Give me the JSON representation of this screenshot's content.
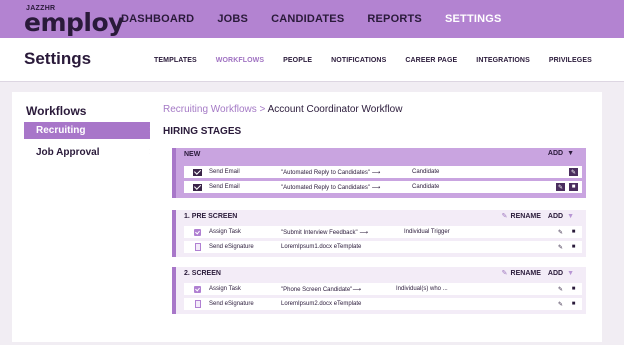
{
  "brand": {
    "small": "JAZZHR",
    "main": "employ"
  },
  "topnav": {
    "items": [
      {
        "label": "DASHBOARD"
      },
      {
        "label": "JOBS"
      },
      {
        "label": "CANDIDATES"
      },
      {
        "label": "REPORTS"
      },
      {
        "label": "SETTINGS",
        "active": true
      }
    ]
  },
  "settings": {
    "title": "Settings",
    "tabs": [
      {
        "label": "TEMPLATES"
      },
      {
        "label": "WORKFLOWS",
        "active": true
      },
      {
        "label": "PEOPLE"
      },
      {
        "label": "NOTIFICATIONS"
      },
      {
        "label": "CAREER PAGE"
      },
      {
        "label": "INTEGRATIONS"
      },
      {
        "label": "PRIVILEGES"
      }
    ]
  },
  "sidebar": {
    "title": "Workflows",
    "items": [
      {
        "label": "Recruiting",
        "active": true
      },
      {
        "label": "Job Approval"
      }
    ]
  },
  "main": {
    "breadcrumb": {
      "parent": "Recruiting Workflows",
      "separator": " > ",
      "current": "Account Coordinator Workflow"
    },
    "section_title": "HIRING STAGES",
    "stages": [
      {
        "name": "NEW",
        "add_label": "ADD",
        "rows": [
          {
            "icon": "mail-icon",
            "action": "Send Email",
            "detail": "\"Automated Reply to Candidates\"",
            "arrow": "⟶",
            "target": "Candidate"
          },
          {
            "icon": "mail-icon",
            "action": "Send Email",
            "detail": "\"Automated Reply to Candidates\"",
            "arrow": "⟶",
            "target": "Candidate"
          }
        ]
      },
      {
        "name": "1. PRE SCREEN",
        "rename_label": "RENAME",
        "add_label": "ADD",
        "rows": [
          {
            "icon": "task-icon",
            "action": "Assign Task",
            "detail": "\"Submit Interview Feedback\"",
            "arrow": "⟶",
            "target": "Individual Trigger"
          },
          {
            "icon": "signature-icon",
            "action": "Send eSignature",
            "detail": "LoremIpsum1.docx eTemplate",
            "arrow": "",
            "target": ""
          }
        ]
      },
      {
        "name": "2. SCREEN",
        "rename_label": "RENAME",
        "add_label": "ADD",
        "rows": [
          {
            "icon": "task-icon",
            "action": "Assign Task",
            "detail": "\"Phone Screen Candidate\"",
            "arrow": "⟶",
            "target": "Individual(s) who ..."
          },
          {
            "icon": "signature-icon",
            "action": "Send eSignature",
            "detail": "LoremIpsum2.docx eTemplate",
            "arrow": "",
            "target": ""
          }
        ]
      }
    ]
  },
  "colors": {
    "nav_bg": "#b383d1",
    "accent": "#a876c9",
    "new_stage_bg": "#c9a4e0",
    "stage_bg": "#f3ecf7",
    "dark_button": "#4a2d5e"
  }
}
